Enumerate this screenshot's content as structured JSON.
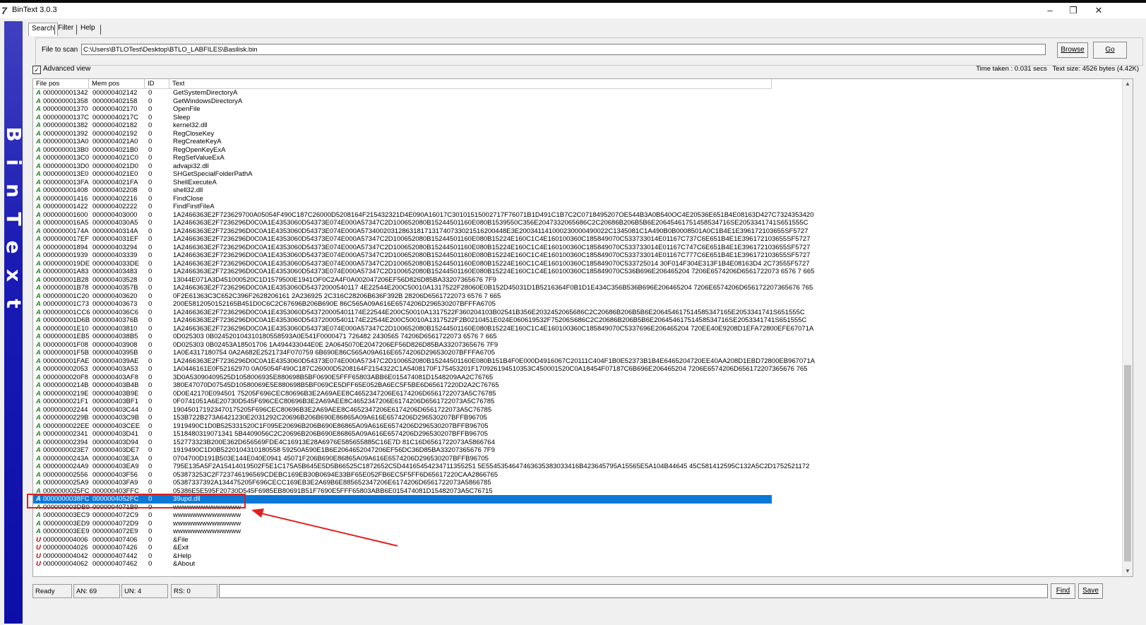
{
  "window": {
    "title": "BinText 3.0.3",
    "minimize": "–",
    "restore": "❐",
    "close": "✕"
  },
  "tabs": [
    "Search",
    "Filter",
    "Help"
  ],
  "file": {
    "label": "File to scan",
    "value": "C:\\Users\\BTLOTest\\Desktop\\BTLO_LABFILES\\Basilisk.bin",
    "browse": "Browse",
    "go": "Go"
  },
  "advanced": {
    "label": "Advanced view",
    "checked": "✓"
  },
  "info": {
    "time": "Time taken : 0.031 secs",
    "size": "Text size: 4526 bytes (4.42K)"
  },
  "columns": [
    "File pos",
    "Mem pos",
    "ID",
    "Text"
  ],
  "rows": [
    {
      "t": "A",
      "f": "000000001342",
      "m": "000000402142",
      "id": "0",
      "x": "GetSystemDirectoryA"
    },
    {
      "t": "A",
      "f": "000000001358",
      "m": "000000402158",
      "id": "0",
      "x": "GetWindowsDirectoryA"
    },
    {
      "t": "A",
      "f": "000000001370",
      "m": "000000402170",
      "id": "0",
      "x": "OpenFile"
    },
    {
      "t": "A",
      "f": "00000000137C",
      "m": "00000040217C",
      "id": "0",
      "x": "Sleep"
    },
    {
      "t": "A",
      "f": "000000001382",
      "m": "000000402182",
      "id": "0",
      "x": "kernel32.dll"
    },
    {
      "t": "A",
      "f": "000000001392",
      "m": "000000402192",
      "id": "0",
      "x": "RegCloseKey"
    },
    {
      "t": "A",
      "f": "0000000013A0",
      "m": "0000004021A0",
      "id": "0",
      "x": "RegCreateKeyA"
    },
    {
      "t": "A",
      "f": "0000000013B0",
      "m": "0000004021B0",
      "id": "0",
      "x": "RegOpenKeyExA"
    },
    {
      "t": "A",
      "f": "0000000013C0",
      "m": "0000004021C0",
      "id": "0",
      "x": "RegSetValueExA"
    },
    {
      "t": "A",
      "f": "0000000013D0",
      "m": "0000004021D0",
      "id": "0",
      "x": "advapi32.dll"
    },
    {
      "t": "A",
      "f": "0000000013E0",
      "m": "0000004021E0",
      "id": "0",
      "x": "SHGetSpecialFolderPathA"
    },
    {
      "t": "A",
      "f": "0000000013FA",
      "m": "0000004021FA",
      "id": "0",
      "x": "ShellExecuteA"
    },
    {
      "t": "A",
      "f": "000000001408",
      "m": "000000402208",
      "id": "0",
      "x": "shell32.dll"
    },
    {
      "t": "A",
      "f": "000000001416",
      "m": "000000402216",
      "id": "0",
      "x": "FindClose"
    },
    {
      "t": "A",
      "f": "000000001422",
      "m": "000000402222",
      "id": "0",
      "x": "FindFirstFileA"
    },
    {
      "t": "A",
      "f": "000000001600",
      "m": "000000403000",
      "id": "0",
      "x": "1A2466363E2F723629700A05054F490C187C26000D5208164F215432321D4E090A16017C30101515002717F76071B1D491C1B7C2C0718495207OE544B3A0B540OC4E20536E651B4E08163D427C7324353420"
    },
    {
      "t": "A",
      "f": "0000000016A5",
      "m": "0000004030A5",
      "id": "0",
      "x": "1A2466363E2F7236296D0C0A1E4353060D54373E074E000A57347C2D100652080B15244501160E080B1539550C356E2047332065686C2C20686B206B5B6E20645461751458534716SE2053341741S651555C"
    },
    {
      "t": "A",
      "f": "00000000174A",
      "m": "00000040314A",
      "id": "0",
      "x": "1A2466363E2F7236296D0C0A1E4353060D54373E074E000A573400203128631817131740733021516200448E3E200341141000230000490022C1345081C1A490B0B0008501A0C1B4E1E396172103655SF5727"
    },
    {
      "t": "A",
      "f": "0000000017EF",
      "m": "0000004031EF",
      "id": "0",
      "x": "1A2466363E2F7236296D0C0A1E4353060D54373E074E000A57347C2D100652080B15244501160E080B15224E160C1C4E160100360C185849070C533733014E01167C737C6E651B4E1E396172103655SF5727"
    },
    {
      "t": "A",
      "f": "000000001894",
      "m": "000000403294",
      "id": "0",
      "x": "1A2466363E2F7236296D0C0A1E4353060D54373E074E000A57347C2D100652080B15244501160E080B15224E160C1C4E160100360C185849070C533733014E01167C747C6E651B4E1E396172103655SF5727"
    },
    {
      "t": "A",
      "f": "000000001939",
      "m": "000000403339",
      "id": "0",
      "x": "1A2466363E2F7236296D0C0A1E4353060D54373E074E000A57347C2D100652080B15244501160E080B15224E160C1C4E160100360C185849070C533733014E01167C777C6E651B4E1E396172103655SF5727"
    },
    {
      "t": "A",
      "f": "0000000019DE",
      "m": "0000004033DE",
      "id": "0",
      "x": "1A2466363E2F7236296D0C0A1E4353060D54373E074E000A57347C2D100652080B15244501160E080B15224E160C1C4E160100360C185849070C533725014 30F014F304E313F1B4E08163D4 2C73555F5727"
    },
    {
      "t": "A",
      "f": "000000001A83",
      "m": "000000403483",
      "id": "0",
      "x": "1A2466363E2F7236296D0C0A1E4353060D54373E074E000A57347C2D100652080B15244501160E080B15224E160C1C4E160100360C185849070C536B696E206465204 7206E6574206D6561722073 6576 7 665"
    },
    {
      "t": "A",
      "f": "000000001B28",
      "m": "000000403528",
      "id": "0",
      "x": "13044E071A3D451000520C1D1579500E1941OF0C2A4F0A002047206EF56D826D85BA33207365676 7F9"
    },
    {
      "t": "A",
      "f": "000000001B78",
      "m": "00000040357B",
      "id": "0",
      "x": "1A2466363E2F7236296D0C0A1E4353060D54372000540117 4E22544E200C50010A1317522F28060E0B152D45031D1B5216364F0B1D1E434C356B536B696E206465204 7206E6574206D656172207365676 765"
    },
    {
      "t": "A",
      "f": "000000001C20",
      "m": "000000403620",
      "id": "0",
      "x": "0F2E61363C3C652C396F2628206161 2A236925 2C316C28206B636F392B 28206D6561722073 6576 7 665"
    },
    {
      "t": "A",
      "f": "000000001C73",
      "m": "000000403673",
      "id": "0",
      "x": "200E5812050152165B451D0C6C2C67696B206B690E 86C565A09A616E6574206D296530207BFFFA6705"
    },
    {
      "t": "A",
      "f": "000000001CC6",
      "m": "0000004036C6",
      "id": "0",
      "x": "1A2466363E2F7236296D0C0A1E4353060D543720005401174E22544E200C50010A1317522F360204103B02541B356E2032452065686C2C20686B206B5B6E206454617514585347165E2053341741S651555C"
    },
    {
      "t": "A",
      "f": "000000001D6B",
      "m": "00000040376B",
      "id": "0",
      "x": "1A2466363E2F7236296D0C0A1E4353060D543720005401174E22544E200C50010A1317522F2B0210451E024E060619532F75206S686C2C20686B206B5B6E20645461751458534716SE2053341741S651555C"
    },
    {
      "t": "A",
      "f": "000000001E10",
      "m": "000000403810",
      "id": "0",
      "x": "1A2466363E2F7236296D0C0A1E4353060D54373E074E000A57347C2D100652080B15244501160E080B15224E160C1C4E160100360C185849070C5337696E206465204 720EE40E9208D1EFA72800EFE67071A"
    },
    {
      "t": "A",
      "f": "000000001EB5",
      "m": "0000004038B5",
      "id": "0",
      "x": "0D025303 0B024520104310180558593A0E541F0000471 726482 2430565 74206D6561722073 6576 7 665"
    },
    {
      "t": "A",
      "f": "000000001F08",
      "m": "000000403908",
      "id": "0",
      "x": "0D025303 0B02453A18501706 1A494433044E0E 2A0645070E2047206EF56D826D85BA33207365676 7F9"
    },
    {
      "t": "A",
      "f": "000000001F5B",
      "m": "00000040395B",
      "id": "0",
      "x": "1A0E4317180754 0A2A682E2521734F070759 6B690E86C565A09A616E6574206D296530207BFFFA6705"
    },
    {
      "t": "A",
      "f": "000000001FAE",
      "m": "0000004039AE",
      "id": "0",
      "x": "1A2466363E2F7236296D0C0A1E4353060D54373E074E000A57347C2D100652080B15244501160E080B151B4F0E000D4916067C20111C404F1B0E52373B1B4E6465204720EE40AA208D1EBD72800EB967071A"
    },
    {
      "t": "A",
      "f": "000000002053",
      "m": "000000403A53",
      "id": "0",
      "x": "1A0446161E0F52162970 0A05054F490C187C26000D5208164F2154322C1A5408170F175453201F170926194510353C450001520C0A18454F07187C6B696E206465204 7206E6574206D656172207365676 765"
    },
    {
      "t": "A",
      "f": "0000000020F8",
      "m": "000000403AF8",
      "id": "0",
      "x": "3D0A53090409525D1058006935E880698B5BF0690E5FFF65803ABB6E015474081D1548209AA2C76765"
    },
    {
      "t": "A",
      "f": "00000000214B",
      "m": "000000403B4B",
      "id": "0",
      "x": "380E47070D07545D10580069E5E880698B5BF069CE5DFF65E052BA6EC5F5BE6D65617220D2A2C76765"
    },
    {
      "t": "A",
      "f": "00000000219E",
      "m": "000000403B9E",
      "id": "0",
      "x": "0D0E42170E094501 75205F696CEC80696B3E2A69AEE8C4652347206E6174206D6561722073A5C76785"
    },
    {
      "t": "A",
      "f": "0000000021F1",
      "m": "000000403BF1",
      "id": "0",
      "x": "0F0741051A6E20730D545F696CEC80696B3E2A69AEE8C4652347206E6174206D6561722073A5C76785"
    },
    {
      "t": "A",
      "f": "000000002244",
      "m": "000000403C44",
      "id": "0",
      "x": "190450171923470175205F696CEC80696B3E2A69AEE8C4652347206E6174206D6561722073A5C76785"
    },
    {
      "t": "A",
      "f": "00000000229B",
      "m": "000000403C9B",
      "id": "0",
      "x": "153B722B273A6421230E2031292C20696B206B690E86865A09A616E6574206D296530207BFFB96705"
    },
    {
      "t": "A",
      "f": "0000000022EE",
      "m": "000000403CEE",
      "id": "0",
      "x": "1919490C1D0B525331520C1F095E20696B206B690E86865A09A616E6574206D296530207BFFB96705"
    },
    {
      "t": "A",
      "f": "000000002341",
      "m": "000000403D41",
      "id": "0",
      "x": "1518480319071341 5B4409056C2C20696B206B690E86865A09A616E6574206D296530207BFFB96705"
    },
    {
      "t": "A",
      "f": "000000002394",
      "m": "000000403D94",
      "id": "0",
      "x": "152773323B200E362D656569FDE4C16913E28A6976E585655885C16E7D 81C16D6561722073A5866764"
    },
    {
      "t": "A",
      "f": "0000000023E7",
      "m": "000000403DE7",
      "id": "0",
      "x": "1919490C1D0B5220104310180558 59250A590E1B6E2064652047206EF56DC36D85BA33207365676 7F9"
    },
    {
      "t": "A",
      "f": "00000000243A",
      "m": "000000403E3A",
      "id": "0",
      "x": "0704700D191B503E144E040E0941 45071F206B690E86865A09A616E6574206D296530207BFFB96705"
    },
    {
      "t": "A",
      "f": "0000000024A9",
      "m": "000000403EA9",
      "id": "0",
      "x": "795E135A5F2A15414019502F5E1C175A5B645E5D5B66525C1872652C5D44165454234711355251 5E5545354647463635383033416B423645795A15565E5A104B44645 45C581412595C132A5C2D1752521172"
    },
    {
      "t": "A",
      "f": "000000002556",
      "m": "000000403F56",
      "id": "0",
      "x": "053873253C2F723746196569CDEBC169EB30B0694E33BF65E052FB6EC5F5FF6D65617220CAA2866765"
    },
    {
      "t": "A",
      "f": "0000000025A9",
      "m": "000000403FA9",
      "id": "0",
      "x": "05387337392A134475205F696CECC169EB3E2A69B6E885652347206E6174206D6561722073A5866785"
    },
    {
      "t": "A",
      "f": "0000000025FC",
      "m": "000000403FFC",
      "id": "0",
      "x": "05386E5E595F20730D545F6985EB80691B51F7690E5FFF65803ABB6E015474081D15482073A5C76715"
    },
    {
      "t": "A",
      "f": "0000000038FC",
      "m": "0000004052FC",
      "id": "0",
      "x": "39upd.dll",
      "sel": true
    },
    {
      "t": "A",
      "f": "000000003DB9",
      "m": "0000004071B9",
      "id": "0",
      "x": "wwwwwwwwwwwwww"
    },
    {
      "t": "A",
      "f": "000000003EC9",
      "m": "0000004072C9",
      "id": "0",
      "x": "wwwwwwwwwwwwww"
    },
    {
      "t": "A",
      "f": "000000003ED9",
      "m": "0000004072D9",
      "id": "0",
      "x": "wwwwwwwwwwwwww"
    },
    {
      "t": "A",
      "f": "000000003EE9",
      "m": "0000004072E9",
      "id": "0",
      "x": "wwwwwwwwwwwwww"
    },
    {
      "t": "U",
      "f": "000000004006",
      "m": "000000407406",
      "id": "0",
      "x": "&File"
    },
    {
      "t": "U",
      "f": "000000004026",
      "m": "000000407426",
      "id": "0",
      "x": "&Exit"
    },
    {
      "t": "U",
      "f": "000000004042",
      "m": "000000407442",
      "id": "0",
      "x": "&Help"
    },
    {
      "t": "U",
      "f": "000000004062",
      "m": "000000407462",
      "id": "0",
      "x": "&About"
    }
  ],
  "status": {
    "ready": "Ready",
    "an": "AN: 69",
    "un": "UN: 4",
    "rs": "RS: 0",
    "find": "Find",
    "save": "Save"
  },
  "banner": "BinText",
  "colors": {
    "ansi": "#1a8a1a",
    "unicode": "#c00000",
    "selection": "#0a78d7",
    "annotation": "#e21e1e"
  }
}
